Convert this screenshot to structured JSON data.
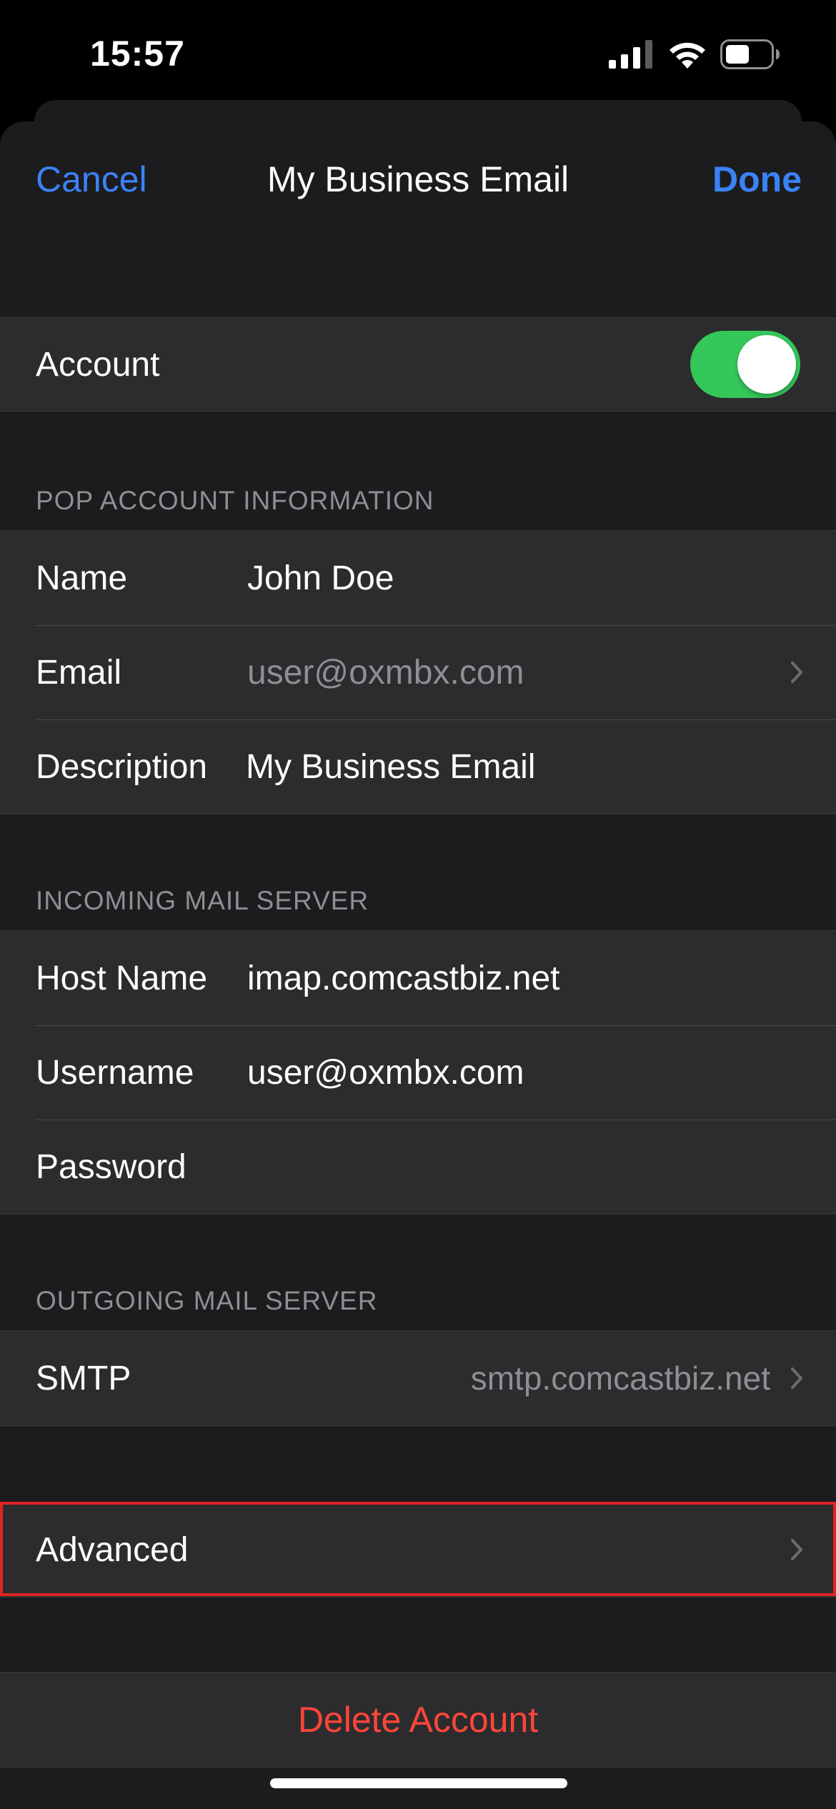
{
  "status_bar": {
    "time": "15:57"
  },
  "nav": {
    "cancel_label": "Cancel",
    "title": "My Business Email",
    "done_label": "Done"
  },
  "account_row": {
    "label": "Account",
    "toggle_on": true
  },
  "pop_section": {
    "header": "POP ACCOUNT INFORMATION",
    "rows": [
      {
        "label": "Name",
        "value": "John Doe"
      },
      {
        "label": "Email",
        "value": "user@oxmbx.com"
      },
      {
        "label": "Description",
        "value": "My Business Email"
      }
    ]
  },
  "incoming_section": {
    "header": "INCOMING MAIL SERVER",
    "rows": [
      {
        "label": "Host Name",
        "value": "imap.comcastbiz.net"
      },
      {
        "label": "Username",
        "value": "user@oxmbx.com"
      },
      {
        "label": "Password",
        "value": ""
      }
    ]
  },
  "outgoing_section": {
    "header": "OUTGOING MAIL SERVER",
    "smtp_label": "SMTP",
    "smtp_value": "smtp.comcastbiz.net"
  },
  "advanced": {
    "label": "Advanced"
  },
  "delete": {
    "label": "Delete Account"
  },
  "colors": {
    "accent": "#3b82f6",
    "toggle_on": "#34c759",
    "destructive": "#ff453a",
    "highlight": "#e02424"
  }
}
